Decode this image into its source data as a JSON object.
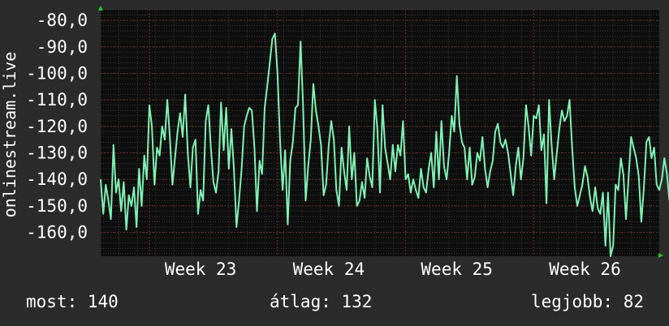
{
  "colors": {
    "background": "#2b2b2b",
    "plot_background": "#0e0e0e",
    "grid_minor": "#3a3a3a",
    "grid_major": "#6a2a2a",
    "series": "#7ef2b4",
    "text": "#ffffff",
    "axis_arrow": "#22cc22"
  },
  "stats": {
    "current": "most: 140",
    "average": "átlag: 132",
    "best": "legjobb: 82"
  },
  "chart_data": {
    "type": "line",
    "ylabel": "onlinestream.live",
    "xlabel": "",
    "title": "",
    "grid": true,
    "legend": "none",
    "ylim": [
      -169,
      -76
    ],
    "yticks": [
      -80,
      -90,
      -100,
      -110,
      -120,
      -130,
      -140,
      -150,
      -160
    ],
    "ytick_labels": [
      "-80,0",
      "-90,0",
      "-100,0",
      "-110,0",
      "-120,0",
      "-130,0",
      "-140,0",
      "-150,0",
      "-160,0"
    ],
    "xlim": [
      0,
      218
    ],
    "xticks": [
      {
        "x": 39,
        "label": "Week 23"
      },
      {
        "x": 89,
        "label": "Week 24"
      },
      {
        "x": 139,
        "label": "Week 25"
      },
      {
        "x": 189,
        "label": "Week 26"
      }
    ],
    "xgrid_major": [
      19,
      69,
      119,
      169
    ],
    "series": [
      {
        "values": [
          -140,
          -153,
          -142,
          -148,
          -155,
          -127,
          -145,
          -140,
          -152,
          -141,
          -159,
          -146,
          -150,
          -143,
          -158,
          -136,
          -150,
          -131,
          -140,
          -112,
          -120,
          -142,
          -128,
          -131,
          -120,
          -125,
          -110,
          -124,
          -142,
          -132,
          -122,
          -115,
          -124,
          -108,
          -130,
          -143,
          -128,
          -125,
          -153,
          -144,
          -148,
          -118,
          -112,
          -128,
          -141,
          -145,
          -137,
          -111,
          -129,
          -113,
          -136,
          -121,
          -136,
          -158,
          -148,
          -136,
          -120,
          -116,
          -113,
          -114,
          -128,
          -152,
          -133,
          -138,
          -113,
          -105,
          -96,
          -87,
          -85,
          -100,
          -125,
          -144,
          -129,
          -157,
          -133,
          -126,
          -113,
          -112,
          -88,
          -112,
          -148,
          -135,
          -125,
          -104,
          -114,
          -120,
          -127,
          -146,
          -142,
          -127,
          -118,
          -125,
          -144,
          -150,
          -128,
          -137,
          -144,
          -120,
          -140,
          -130,
          -150,
          -148,
          -141,
          -147,
          -132,
          -139,
          -143,
          -110,
          -121,
          -145,
          -112,
          -128,
          -134,
          -140,
          -127,
          -137,
          -127,
          -131,
          -118,
          -140,
          -138,
          -145,
          -140,
          -144,
          -147,
          -136,
          -143,
          -145,
          -136,
          -130,
          -143,
          -122,
          -140,
          -118,
          -135,
          -140,
          -130,
          -116,
          -122,
          -101,
          -119,
          -126,
          -128,
          -140,
          -128,
          -142,
          -139,
          -130,
          -133,
          -124,
          -136,
          -143,
          -137,
          -133,
          -122,
          -119,
          -126,
          -128,
          -125,
          -130,
          -138,
          -146,
          -135,
          -128,
          -140,
          -132,
          -112,
          -120,
          -131,
          -116,
          -117,
          -112,
          -129,
          -123,
          -149,
          -110,
          -127,
          -140,
          -130,
          -121,
          -114,
          -118,
          -116,
          -110,
          -128,
          -143,
          -150,
          -146,
          -142,
          -135,
          -139,
          -147,
          -152,
          -143,
          -151,
          -153,
          -145,
          -165,
          -145,
          -170,
          -165,
          -142,
          -144,
          -132,
          -138,
          -155,
          -140,
          -124,
          -128,
          -132,
          -139,
          -156,
          -143,
          -126,
          -124,
          -132,
          -128,
          -142,
          -144,
          -140,
          -132,
          -138,
          -148,
          -139,
          -141,
          -136,
          -141
        ],
        "color": "#7ef2b4"
      }
    ]
  }
}
